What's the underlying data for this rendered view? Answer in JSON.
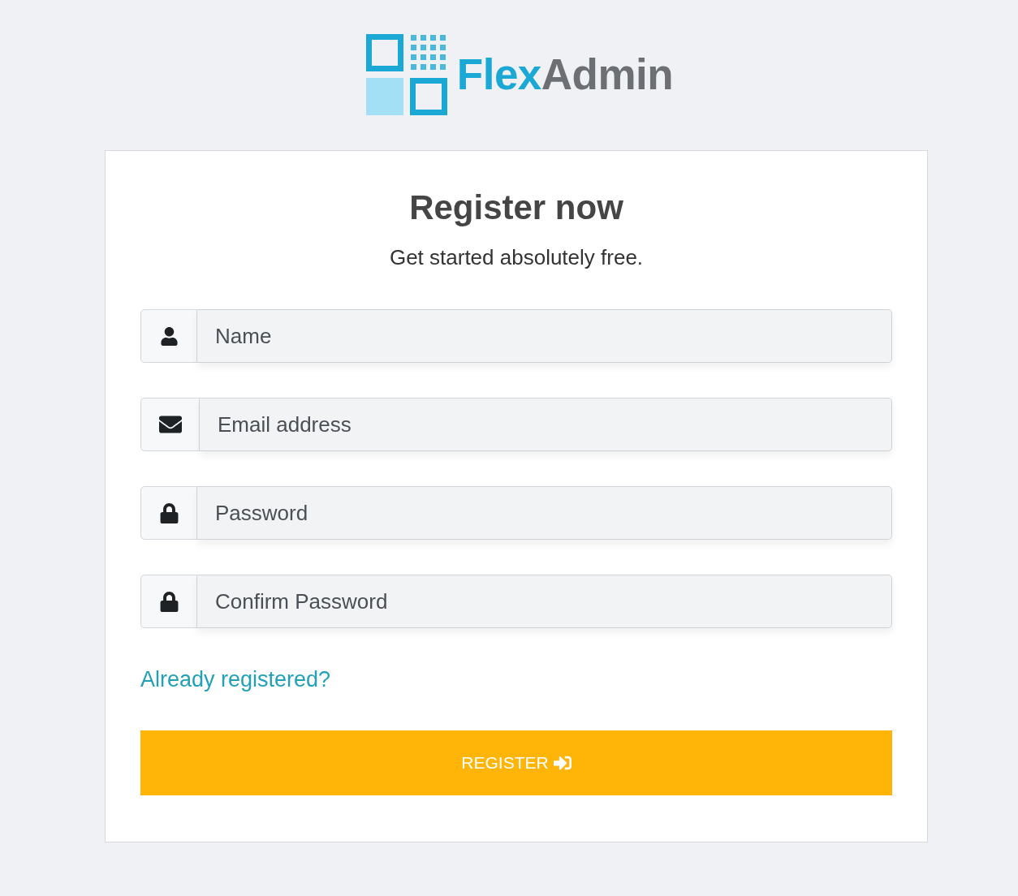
{
  "logo": {
    "name_first": "Flex",
    "name_second": "Admin"
  },
  "heading": "Register now",
  "subheading": "Get started absolutely free.",
  "fields": [
    {
      "kind": "name",
      "placeholder": "Name"
    },
    {
      "kind": "email",
      "placeholder": "Email address"
    },
    {
      "kind": "password",
      "placeholder": "Password"
    },
    {
      "kind": "password",
      "placeholder": "Confirm Password"
    }
  ],
  "login_link": "Already registered?",
  "submit_button": "REGISTER"
}
